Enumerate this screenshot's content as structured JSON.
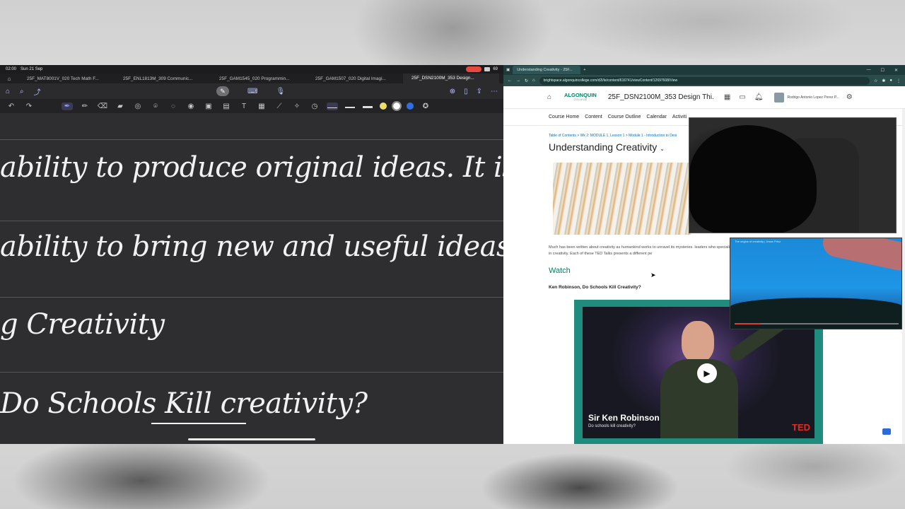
{
  "ipad": {
    "status": {
      "time": "02:00",
      "date": "Sun 21 Sep",
      "battery": "69"
    },
    "tabs": [
      {
        "label": "25F_MAT8001V_020 Tech Math F..."
      },
      {
        "label": "25F_ENL1813M_309 Communic..."
      },
      {
        "label": "25F_GAM1545_020 Programmin..."
      },
      {
        "label": "25F_GAM1507_020 Digital Imagi..."
      },
      {
        "label": "25F_DSN2100M_353 Design..."
      }
    ],
    "toolbar_icons": [
      "home-icon",
      "search-icon",
      "share-icon",
      "pen-mode-icon",
      "keyboard-icon",
      "microphone-icon",
      "add-page-icon",
      "bookmark-icon",
      "export-icon",
      "more-icon"
    ],
    "tools": [
      "undo-icon",
      "redo-icon",
      "pen-icon",
      "pencil-icon",
      "eraser-icon",
      "highlighter-icon",
      "shapes-icon",
      "lasso-icon",
      "text-lasso-icon",
      "eye-icon",
      "sticker-icon",
      "image-icon",
      "textbox-icon",
      "camera-icon",
      "ruler-icon",
      "laser-icon",
      "clock-icon"
    ],
    "pen_colors": [
      "#ecdf6a",
      "#ffffff",
      "#2f6fe0"
    ],
    "notes": [
      {
        "text": "ability to produce original ideas. It is both the pro"
      },
      {
        "text": "ability to bring new and useful ideas to life"
      },
      {
        "text": "g Creativity"
      },
      {
        "text": "Do Schools Kill creativity?"
      }
    ]
  },
  "browser": {
    "tab_title": "Understanding Creativity - 25F...",
    "url": "brightspace.algonquincollege.com/d2l/le/content/616741/viewContent/12697608/View",
    "logo": {
      "name": "ALGONQUIN",
      "sub": "COLLEGE"
    },
    "course_title": "25F_DSN2100M_353 Design Thi...",
    "user_name": "Rodrigo Antonio Lopez Perez P...",
    "nav": [
      "Course Home",
      "Content",
      "Course Outline",
      "Calendar",
      "Activiti"
    ],
    "breadcrumbs": "Table of Contents  >  Wk 2: MODULE 1, Lesson 1  >  Module 1 - Introduction to Desi",
    "heading": "Understanding Creativity",
    "intro": "Much has been written about creativity as humankind works to unravel its mysteries. leaders who specialize in creativity. Each of these TED Talks presents a different pe",
    "watch": "Watch",
    "talk_title": "Ken Robinson, Do Schools Kill Creativity?",
    "video": {
      "speaker": "Sir Ken Robinson",
      "subtitle": "Do schools kill creativity?",
      "brand": "TED"
    }
  },
  "pip": {
    "title": "The origins of creativity | Jesse Prinz"
  }
}
